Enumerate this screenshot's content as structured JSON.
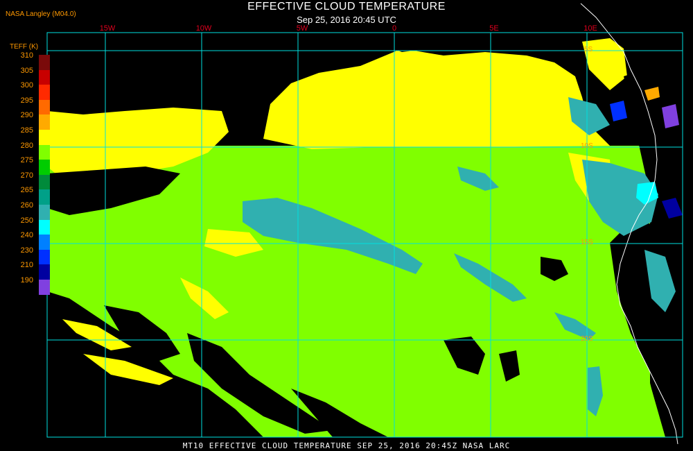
{
  "header": {
    "title": "EFFECTIVE CLOUD TEMPERATURE",
    "datetime": "Sep 25, 2016 20:45 UTC",
    "credit": "NASA Langley (M04.0)"
  },
  "legend": {
    "title": "TEFF (K)",
    "entries": [
      {
        "label": "310",
        "color": "#7a0a0a"
      },
      {
        "label": "305",
        "color": "#c80000"
      },
      {
        "label": "300",
        "color": "#ff2a00"
      },
      {
        "label": "295",
        "color": "#ff6a00"
      },
      {
        "label": "290",
        "color": "#ffaa00"
      },
      {
        "label": "285",
        "color": "#ffff00"
      },
      {
        "label": "280",
        "color": "#80ff00"
      },
      {
        "label": "275",
        "color": "#00cc00"
      },
      {
        "label": "270",
        "color": "#008a3a"
      },
      {
        "label": "265",
        "color": "#00a088"
      },
      {
        "label": "260",
        "color": "#30b0b0"
      },
      {
        "label": "250",
        "color": "#00ffff"
      },
      {
        "label": "240",
        "color": "#0080ff"
      },
      {
        "label": "230",
        "color": "#0030ff"
      },
      {
        "label": "210",
        "color": "#0000a0"
      },
      {
        "label": "190",
        "color": "#8040e0"
      }
    ]
  },
  "grid": {
    "longitudes": [
      "15W",
      "10W",
      "5W",
      "0",
      "5E",
      "10E"
    ],
    "latitudes": [
      "5S",
      "10S",
      "15S",
      "20S"
    ]
  },
  "colors": {
    "yellow": "#ffff00",
    "green": "#80ff00",
    "teal": "#30b0b0",
    "cyan": "#00ffff",
    "gridline": "#00e0e0",
    "coastline": "#ffffff",
    "lon_label": "#e0001e",
    "lat_label": "#ff9900"
  },
  "footer": {
    "text": "MT10  EFFECTIVE CLOUD TEMPERATURE  SEP 25, 2016 20:45Z  NASA LARC"
  }
}
